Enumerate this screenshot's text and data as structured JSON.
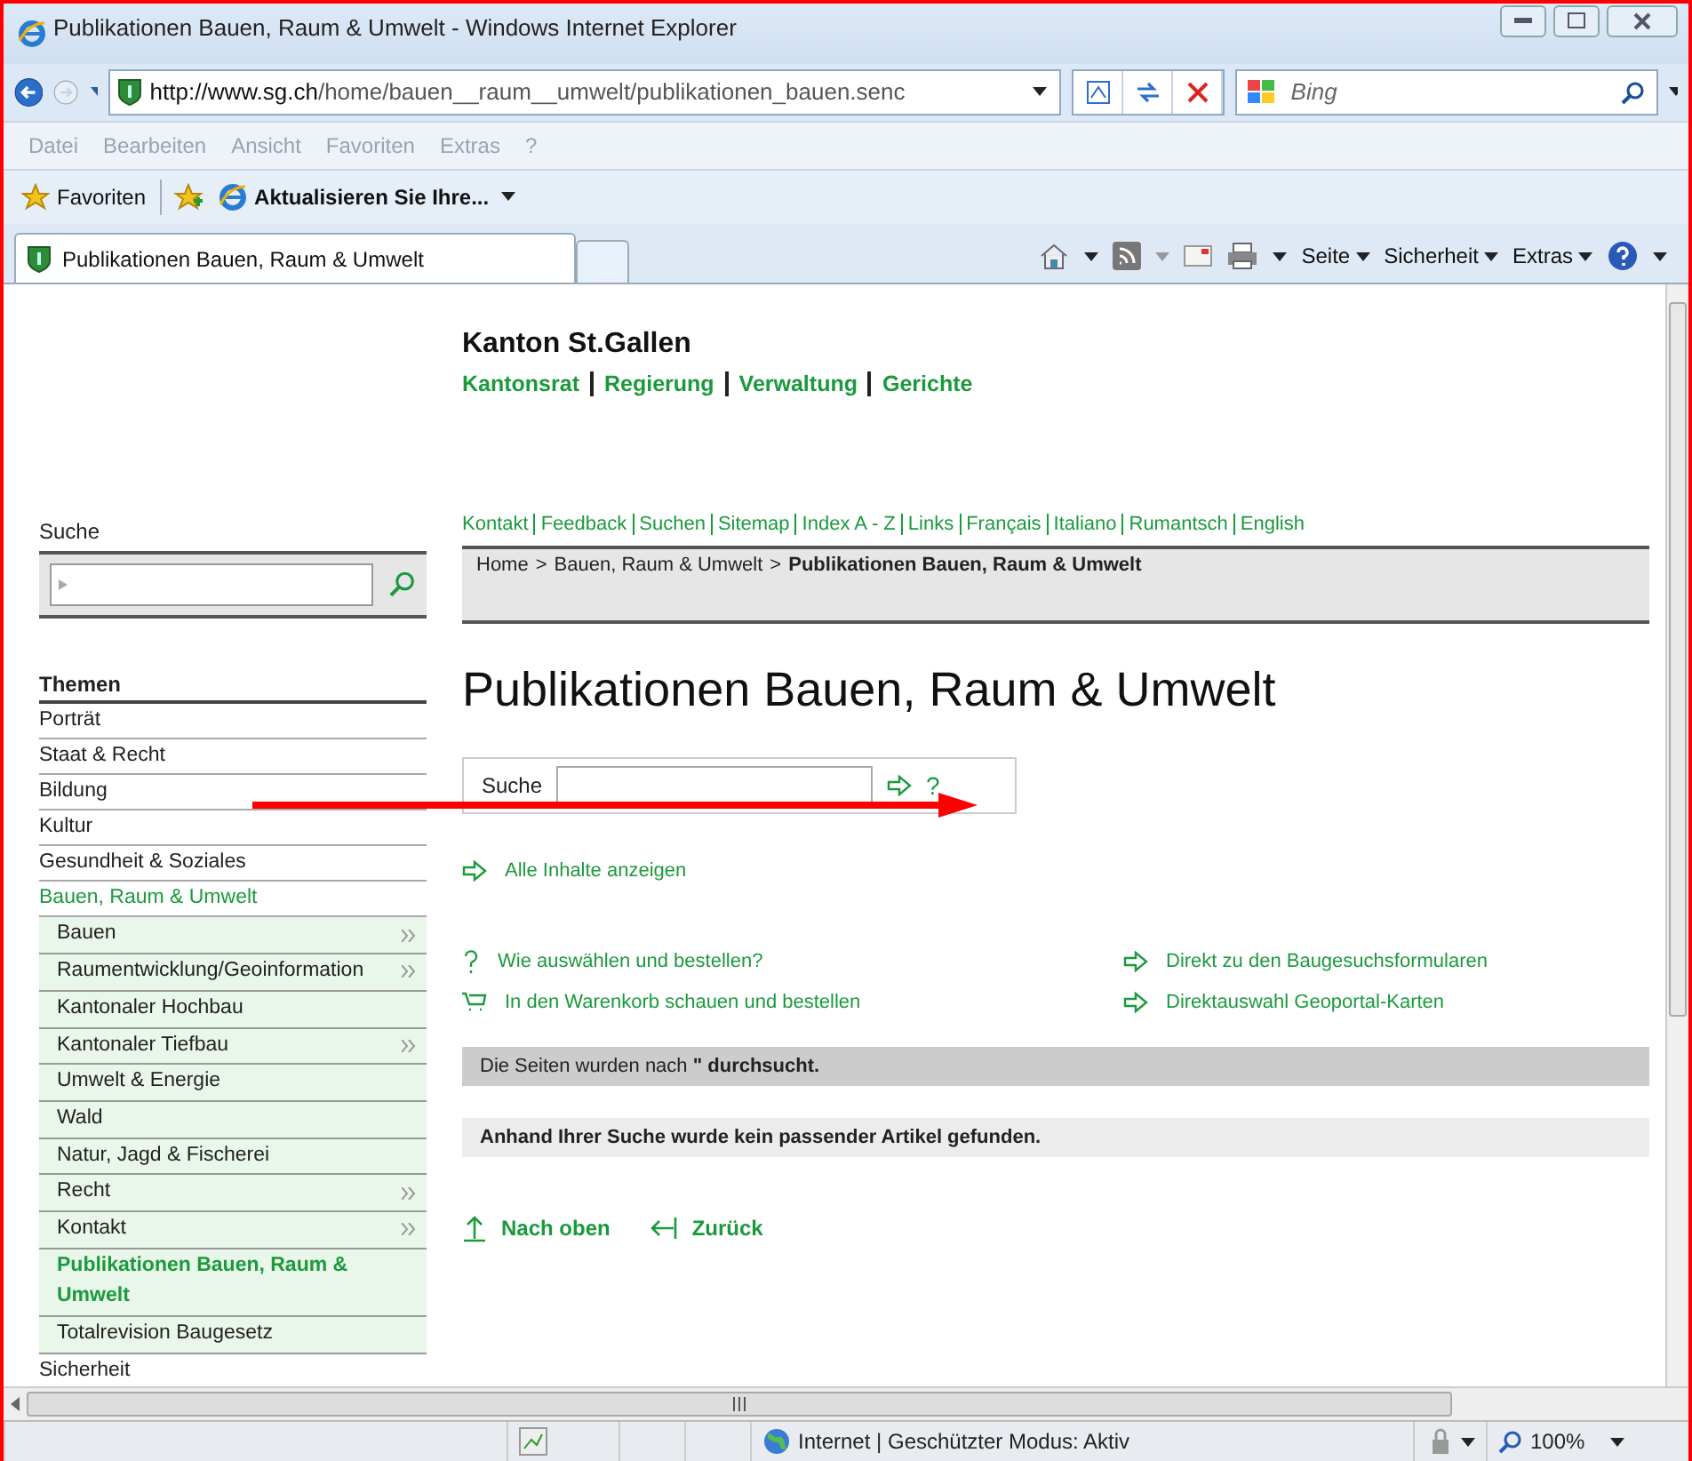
{
  "window": {
    "title": "Publikationen Bauen, Raum & Umwelt - Windows Internet Explorer"
  },
  "address_bar": {
    "url_host": "http://www.sg.ch",
    "url_path": "/home/bauen__raum__umwelt/publikationen_bauen.senc",
    "search_placeholder": "Bing"
  },
  "menu": [
    {
      "label": "Datei"
    },
    {
      "label": "Bearbeiten"
    },
    {
      "label": "Ansicht"
    },
    {
      "label": "Favoriten"
    },
    {
      "label": "Extras"
    },
    {
      "label": "?"
    }
  ],
  "favorites_bar": {
    "label": "Favoriten",
    "suggested": "Aktualisieren Sie Ihre..."
  },
  "tabs": [
    {
      "label": "Publikationen Bauen, Raum & Umwelt",
      "selected": true
    }
  ],
  "command_bar": [
    {
      "label": "Seite"
    },
    {
      "label": "Sicherheit"
    },
    {
      "label": "Extras"
    }
  ],
  "page": {
    "site_title": "Kanton St.Gallen",
    "main_nav": [
      "Kantonsrat",
      "Regierung",
      "Verwaltung",
      "Gerichte"
    ],
    "service_nav": [
      "Kontakt",
      "Feedback",
      "Suchen",
      "Sitemap",
      "Index A - Z",
      "Links",
      "Français",
      "Italiano",
      "Rumantsch",
      "English"
    ],
    "sidebar_search_label": "Suche",
    "breadcrumb": {
      "separator": ">",
      "items": [
        {
          "label": "Home",
          "current": false
        },
        {
          "label": "Bauen, Raum & Umwelt",
          "current": false
        },
        {
          "label": "Publikationen Bauen, Raum & Umwelt",
          "current": true
        }
      ]
    },
    "themes": {
      "heading": "Themen",
      "items": [
        {
          "label": "Porträt",
          "selected": false
        },
        {
          "label": "Staat & Recht",
          "selected": false
        },
        {
          "label": "Bildung",
          "selected": false
        },
        {
          "label": "Kultur",
          "selected": false
        },
        {
          "label": "Gesundheit & Soziales",
          "selected": false
        },
        {
          "label": "Bauen, Raum & Umwelt",
          "selected": true,
          "children": [
            {
              "label": "Bauen",
              "has_submenu": true,
              "selected": false
            },
            {
              "label": "Raumentwicklung/Geoinformation",
              "has_submenu": true,
              "selected": false
            },
            {
              "label": "Kantonaler Hochbau",
              "has_submenu": false,
              "selected": false
            },
            {
              "label": "Kantonaler Tiefbau",
              "has_submenu": true,
              "selected": false
            },
            {
              "label": "Umwelt & Energie",
              "has_submenu": false,
              "selected": false
            },
            {
              "label": "Wald",
              "has_submenu": false,
              "selected": false
            },
            {
              "label": "Natur, Jagd & Fischerei",
              "has_submenu": false,
              "selected": false
            },
            {
              "label": "Recht",
              "has_submenu": true,
              "selected": false
            },
            {
              "label": "Kontakt",
              "has_submenu": true,
              "selected": false
            },
            {
              "label": "Publikationen Bauen, Raum & Umwelt",
              "has_submenu": false,
              "selected": true
            },
            {
              "label": "Totalrevision Baugesetz",
              "has_submenu": false,
              "selected": false
            }
          ]
        },
        {
          "label": "Sicherheit",
          "selected": false
        }
      ]
    },
    "heading": "Publikationen Bauen, Raum & Umwelt",
    "search": {
      "label": "Suche",
      "help": "?"
    },
    "show_all": {
      "kind": "arrow",
      "label": "Alle Inhalte anzeigen"
    },
    "links_left": [
      {
        "kind": "question",
        "label": "Wie auswählen und bestellen?"
      },
      {
        "kind": "cart",
        "label": "In den Warenkorb schauen und bestellen"
      }
    ],
    "links_right": [
      {
        "kind": "arrow",
        "label": "Direkt zu den Baugesuchsformularen"
      },
      {
        "kind": "arrow",
        "label": "Direktauswahl Geoportal-Karten"
      }
    ],
    "search_info": "Die Seiten wurden nach **\" durchsucht.**",
    "no_result": "Anhand Ihrer Suche wurde kein passender Artikel gefunden.",
    "footer_links": [
      {
        "kind": "up",
        "label": "Nach oben"
      },
      {
        "kind": "back",
        "label": "Zurück"
      }
    ]
  },
  "status_bar": {
    "zone": "Internet | Geschützter Modus: Aktiv",
    "zoom": "100%"
  }
}
